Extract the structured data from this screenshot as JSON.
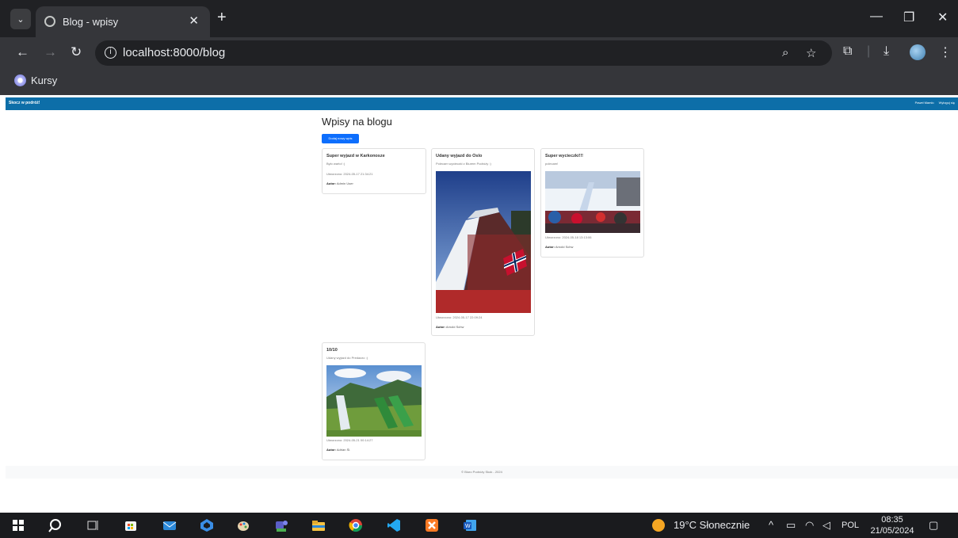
{
  "browser": {
    "tab_title": "Blog - wpisy",
    "tab_close": "✕",
    "new_tab": "+",
    "url": "localhost:8000/blog",
    "bookmark": "Kursy"
  },
  "site": {
    "brand": "Skocz w podróż!",
    "user": "Paweł Mamło",
    "logout": "Wyloguj się",
    "page_title": "Wpisy na blogu",
    "add_button": "Dodaj nowy wpis",
    "footer": "© Biuro Podróży Skok - 2024"
  },
  "posts": [
    {
      "title": "Super wyjazd w Karkonosze",
      "body": "Było warto! :)",
      "date": "Utworzono: 2024-05-17 21:34:21",
      "author_label": "Autor:",
      "author": "Admin User"
    },
    {
      "title": "Udany wyjazd do Oslo",
      "body": "Polecam wycieczki z Biurem Podróży :)",
      "date": "Utworzono: 2024-05-17 22:09:24",
      "author_label": "Autor:",
      "author": "Arnold Schw"
    },
    {
      "title": "Super wycieczki!!!",
      "body": "polecam!",
      "date": "Utworzono: 2024-05-18 13:13:06",
      "author_label": "Autor:",
      "author": "Arnold Schw"
    },
    {
      "title": "10/10",
      "body": "Udany wyjazd do Predazzo :)",
      "date": "Utworzono: 2024-05-21 00:14:27",
      "author_label": "Autor:",
      "author": "Adrian Śl."
    }
  ],
  "taskbar": {
    "weather": "19°C Słonecznie",
    "lang": "POL",
    "time": "08:35",
    "date": "21/05/2024"
  }
}
